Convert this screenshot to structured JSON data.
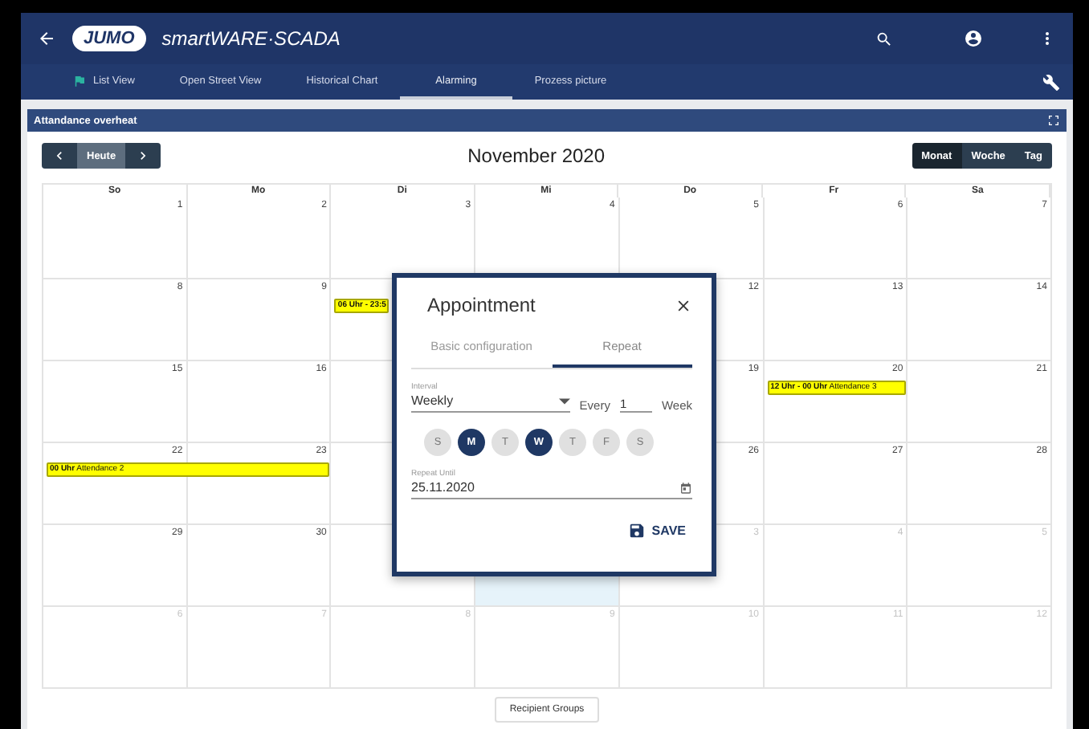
{
  "header": {
    "logo": "JUMO",
    "app_name": "smartWARE·SCADA"
  },
  "nav_tabs": [
    {
      "label": "List View",
      "selected": false
    },
    {
      "label": "Open Street View",
      "selected": false
    },
    {
      "label": "Historical Chart",
      "selected": false
    },
    {
      "label": "Alarming",
      "selected": true
    },
    {
      "label": "Prozess picture",
      "selected": false
    }
  ],
  "panel": {
    "title": "Attandance overheat"
  },
  "calendar": {
    "today_button": "Heute",
    "title": "November 2020",
    "views": [
      {
        "label": "Monat",
        "selected": true
      },
      {
        "label": "Woche",
        "selected": false
      },
      {
        "label": "Tag",
        "selected": false
      }
    ],
    "weekdays": [
      "So",
      "Mo",
      "Di",
      "Mi",
      "Do",
      "Fr",
      "Sa"
    ],
    "weeks": [
      {
        "days": [
          {
            "day": "1",
            "other_month": false,
            "selected": false
          },
          {
            "day": "2",
            "other_month": false,
            "selected": false
          },
          {
            "day": "3",
            "other_month": false,
            "selected": false
          },
          {
            "day": "4",
            "other_month": false,
            "selected": false
          },
          {
            "day": "5",
            "other_month": false,
            "selected": false
          },
          {
            "day": "6",
            "other_month": false,
            "selected": false
          },
          {
            "day": "7",
            "other_month": false,
            "selected": false
          }
        ]
      },
      {
        "left_of_dialog": [
          {
            "day": "8",
            "other_month": false,
            "selected": false
          },
          {
            "day": "9",
            "other_month": false,
            "selected": false
          },
          {
            "selected": false,
            "events": [
              {
                "time": "06 Uhr - 23:5",
                "continues": false
              }
            ]
          }
        ],
        "right_of_dialog": [
          {
            "day": "12",
            "other_month": false,
            "selected": false
          },
          {
            "day": "13",
            "other_month": false,
            "selected": false
          },
          {
            "day": "14",
            "other_month": false,
            "selected": false
          }
        ]
      },
      {
        "left_of_dialog": [
          {
            "day": "15",
            "other_month": false,
            "selected": false
          },
          {
            "day": "16",
            "other_month": false,
            "selected": false
          },
          {
            "selected": false
          }
        ],
        "right_of_dialog": [
          {
            "day": "19",
            "other_month": false,
            "selected": false
          },
          {
            "day": "20",
            "other_month": false,
            "selected": false,
            "events": [
              {
                "time": "12 Uhr - 00 Uhr",
                "title": "Attendance 3",
                "continues": false
              }
            ]
          },
          {
            "day": "21",
            "other_month": false,
            "selected": false
          }
        ]
      },
      {
        "left_of_dialog": [
          {
            "day": "22",
            "other_month": false,
            "selected": false,
            "events": [
              {
                "time": "00 Uhr",
                "title": "Attendance 2",
                "continues": true
              }
            ]
          },
          {
            "day": "23",
            "other_month": false,
            "selected": false
          },
          {
            "selected": false
          }
        ],
        "right_of_dialog": [
          {
            "day": "26",
            "other_month": false,
            "selected": false
          },
          {
            "day": "27",
            "other_month": false,
            "selected": false
          },
          {
            "day": "28",
            "other_month": false,
            "selected": false
          }
        ]
      },
      {
        "days": [
          {
            "day": "29",
            "other_month": false,
            "selected": false
          },
          {
            "day": "30",
            "other_month": false,
            "selected": false
          },
          {
            "selected": false
          },
          {
            "selected": true
          },
          {
            "day": "3",
            "other_month": true,
            "selected": false
          },
          {
            "day": "4",
            "other_month": true,
            "selected": false
          },
          {
            "day": "5",
            "other_month": true,
            "selected": false
          }
        ]
      },
      {
        "days": [
          {
            "day": "6",
            "other_month": true,
            "selected": false
          },
          {
            "day": "7",
            "other_month": true,
            "selected": false
          },
          {
            "day": "8",
            "other_month": true,
            "selected": false
          },
          {
            "day": "9",
            "other_month": true,
            "selected": false
          },
          {
            "day": "10",
            "other_month": true,
            "selected": false
          },
          {
            "day": "11",
            "other_month": true,
            "selected": false
          },
          {
            "day": "12",
            "other_month": true,
            "selected": false
          }
        ]
      }
    ],
    "footer_button": "Recipient Groups"
  },
  "dialog": {
    "title": "Appointment",
    "tabs": [
      {
        "label": "Basic configuration",
        "selected": false
      },
      {
        "label": "Repeat",
        "selected": true
      }
    ],
    "interval": {
      "label": "Interval",
      "value": "Weekly"
    },
    "every": {
      "label": "Every",
      "value": "1",
      "unit": "Week"
    },
    "weekdays": [
      {
        "label": "S",
        "selected": false
      },
      {
        "label": "M",
        "selected": true
      },
      {
        "label": "T",
        "selected": false
      },
      {
        "label": "W",
        "selected": true
      },
      {
        "label": "T",
        "selected": false
      },
      {
        "label": "F",
        "selected": false
      },
      {
        "label": "S",
        "selected": false
      }
    ],
    "repeat_until": {
      "label": "Repeat Until",
      "value": "25.11.2020"
    },
    "save_button": "SAVE"
  }
}
